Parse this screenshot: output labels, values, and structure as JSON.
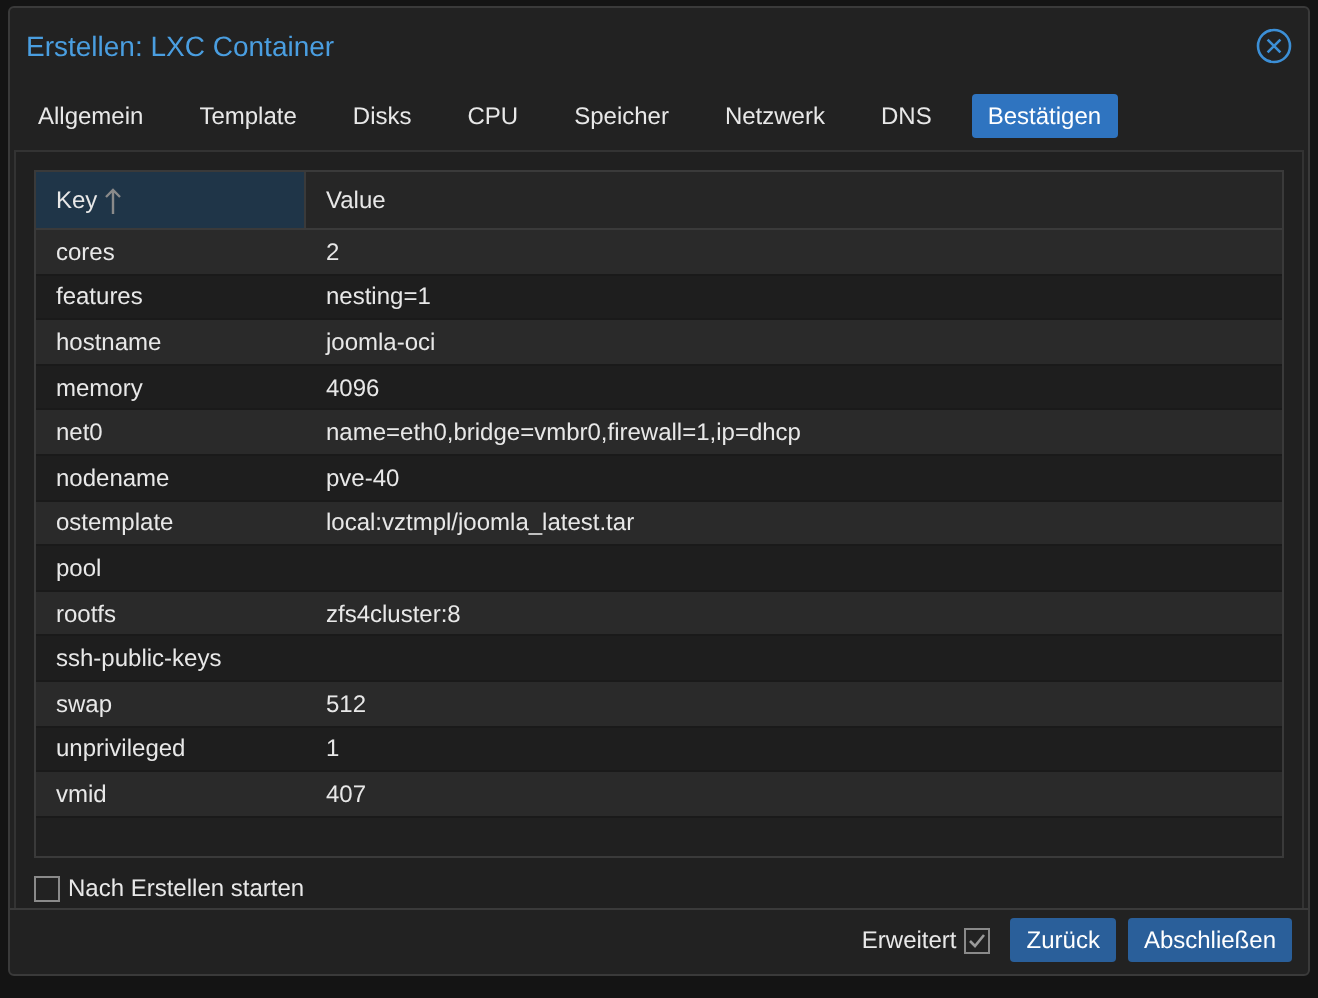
{
  "window": {
    "title": "Erstellen: LXC Container"
  },
  "tabs": [
    {
      "label": "Allgemein",
      "selected": false
    },
    {
      "label": "Template",
      "selected": false
    },
    {
      "label": "Disks",
      "selected": false
    },
    {
      "label": "CPU",
      "selected": false
    },
    {
      "label": "Speicher",
      "selected": false
    },
    {
      "label": "Netzwerk",
      "selected": false
    },
    {
      "label": "DNS",
      "selected": false
    },
    {
      "label": "Bestätigen",
      "selected": true
    }
  ],
  "table": {
    "columns": [
      {
        "label": "Key",
        "sorted": true
      },
      {
        "label": "Value"
      }
    ],
    "rows": [
      [
        "cores",
        "2"
      ],
      [
        "features",
        "nesting=1"
      ],
      [
        "hostname",
        "joomla-oci"
      ],
      [
        "memory",
        "4096"
      ],
      [
        "net0",
        "name=eth0,bridge=vmbr0,firewall=1,ip=dhcp"
      ],
      [
        "nodename",
        "pve-40"
      ],
      [
        "ostemplate",
        "local:vztmpl/joomla_latest.tar"
      ],
      [
        "pool",
        ""
      ],
      [
        "rootfs",
        "zfs4cluster:8"
      ],
      [
        "ssh-public-keys",
        ""
      ],
      [
        "swap",
        "512"
      ],
      [
        "unprivileged",
        "1"
      ],
      [
        "vmid",
        "407"
      ]
    ]
  },
  "start_after_create": {
    "label": "Nach Erstellen starten",
    "checked": false
  },
  "footer": {
    "advanced": {
      "label": "Erweitert",
      "checked": true
    },
    "buttons": [
      "Zurück",
      "Abschließen"
    ]
  }
}
